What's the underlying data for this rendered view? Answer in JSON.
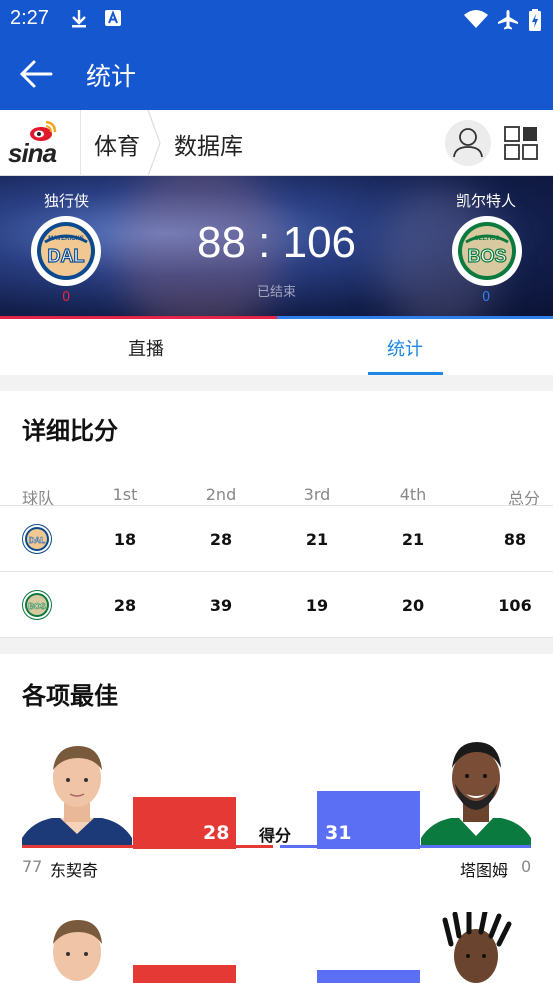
{
  "status_bar": {
    "time": "2:27"
  },
  "app_bar": {
    "title": "统计"
  },
  "subnav": {
    "logo_text": "sina",
    "crumb1": "体育",
    "crumb2": "数据库"
  },
  "game": {
    "home": {
      "name": "独行侠",
      "abbr": "DAL",
      "sub": "MAVERICKS",
      "record": "0",
      "color": "#e5254a"
    },
    "away": {
      "name": "凯尔特人",
      "abbr": "BOS",
      "sub": "CELTICS",
      "record": "0",
      "color": "#2f80ed"
    },
    "score": "88 : 106",
    "status": "已结束",
    "home_share": 0.5
  },
  "tabs": [
    {
      "label": "直播",
      "active": false
    },
    {
      "label": "统计",
      "active": true
    }
  ],
  "box_score": {
    "title": "详细比分",
    "headers": [
      "球队",
      "1st",
      "2nd",
      "3rd",
      "4th",
      "总分"
    ],
    "rows": [
      {
        "team": "DAL",
        "q": [
          "18",
          "28",
          "21",
          "21",
          "88"
        ]
      },
      {
        "team": "BOS",
        "q": [
          "28",
          "39",
          "19",
          "20",
          "106"
        ]
      }
    ]
  },
  "leaders": {
    "title": "各项最佳",
    "items": [
      {
        "stat": "得分",
        "home": {
          "number": "77",
          "name": "东契奇",
          "value": "28"
        },
        "away": {
          "number": "0",
          "name": "塔图姆",
          "value": "31"
        }
      },
      {
        "stat": "",
        "home": {
          "number": "",
          "name": "",
          "value": ""
        },
        "away": {
          "number": "",
          "name": "",
          "value": ""
        }
      }
    ]
  },
  "colors": {
    "primary": "#1457cf",
    "accent": "#1e88e5",
    "home_bar": "#e53935",
    "away_bar": "#5b6ff5"
  },
  "icons": [
    "download-icon",
    "font-icon",
    "wifi-icon",
    "airplane-icon",
    "battery-icon",
    "back-arrow-icon",
    "user-icon",
    "grid-icon"
  ]
}
